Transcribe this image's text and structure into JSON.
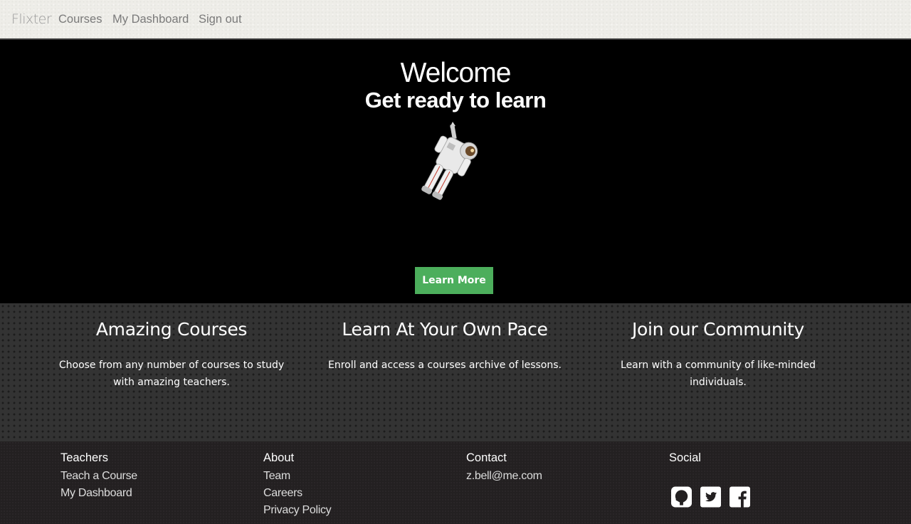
{
  "nav": {
    "brand": "Flixter",
    "links": [
      "Courses",
      "My Dashboard",
      "Sign out"
    ]
  },
  "hero": {
    "title": "Welcome",
    "subtitle": "Get ready to learn",
    "button_label": "Learn More"
  },
  "features": [
    {
      "title": "Amazing Courses",
      "text": "Choose from any number of courses to study with amazing teachers."
    },
    {
      "title": "Learn At Your Own Pace",
      "text": "Enroll and access a courses archive of lessons."
    },
    {
      "title": "Join our Community",
      "text": "Learn with a community of like-minded individuals."
    }
  ],
  "footer": {
    "teachers": {
      "heading": "Teachers",
      "links": [
        "Teach a Course",
        "My Dashboard"
      ]
    },
    "about": {
      "heading": "About",
      "links": [
        "Team",
        "Careers",
        "Privacy Policy"
      ]
    },
    "contact": {
      "heading": "Contact",
      "links": [
        "z.bell@me.com"
      ]
    },
    "social": {
      "heading": "Social",
      "icons": [
        "github-icon",
        "twitter-icon",
        "facebook-icon"
      ]
    }
  },
  "colors": {
    "accent": "#4cae5c",
    "navbar_bg": "#eeede8",
    "hero_bg": "#000000",
    "features_bg": "#333333",
    "footer_bg": "#232021"
  }
}
